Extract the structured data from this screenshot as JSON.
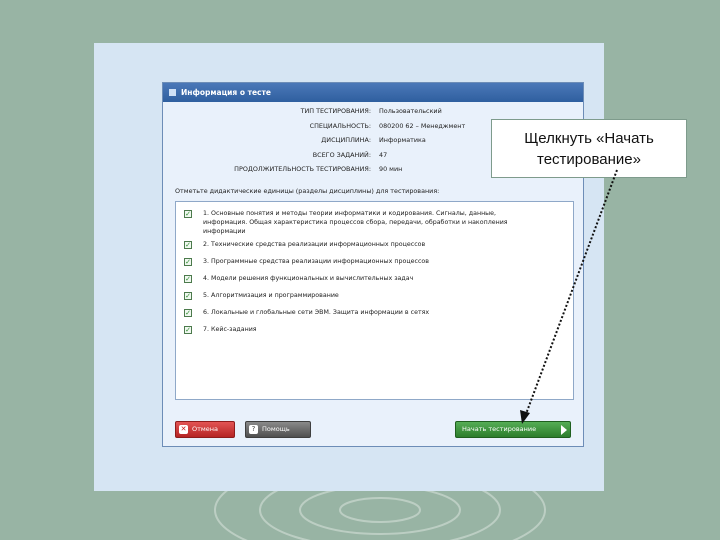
{
  "window": {
    "title": "Информация о тесте"
  },
  "info": [
    {
      "key": "Тип тестирования:",
      "value": "Пользовательский"
    },
    {
      "key": "Специальность:",
      "value": "080200 62 – Менеджмент"
    },
    {
      "key": "Дисциплина:",
      "value": "Информатика"
    },
    {
      "key": "Всего заданий:",
      "value": "47"
    },
    {
      "key": "Продолжительность тестирования:",
      "value": "90 мин"
    }
  ],
  "units_prompt": "Отметьте дидактические единицы (разделы дисциплины) для тестирования:",
  "units": [
    {
      "checked": true,
      "label": "1. Основные понятия и методы теории информатики и кодирования. Сигналы, данные, информация. Общая характеристика процессов сбора, передачи, обработки и накопления информации"
    },
    {
      "checked": true,
      "label": "2. Технические средства реализации информационных процессов"
    },
    {
      "checked": true,
      "label": "3. Программные средства реализации информационных процессов"
    },
    {
      "checked": true,
      "label": "4. Модели решения функциональных и вычислительных задач"
    },
    {
      "checked": true,
      "label": "5. Алгоритмизация и программирование"
    },
    {
      "checked": true,
      "label": "6. Локальные и глобальные сети ЭВМ. Защита информации в сетях"
    },
    {
      "checked": true,
      "label": "7. Кейс-задания"
    }
  ],
  "buttons": {
    "cancel": "Отмена",
    "help": "Помощь",
    "start": "Начать тестирование"
  },
  "callout": {
    "text": "Щелкнуть «Начать тестирование»"
  },
  "colors": {
    "background": "#98b4a4",
    "titlebar": "#3a68a8",
    "start_button": "#3d943d",
    "cancel_button": "#cc3a3a"
  },
  "icons": {
    "cancel": "close-icon",
    "help": "question-icon",
    "start": "play-arrow-icon",
    "units": "checkbox-checked-icon"
  }
}
